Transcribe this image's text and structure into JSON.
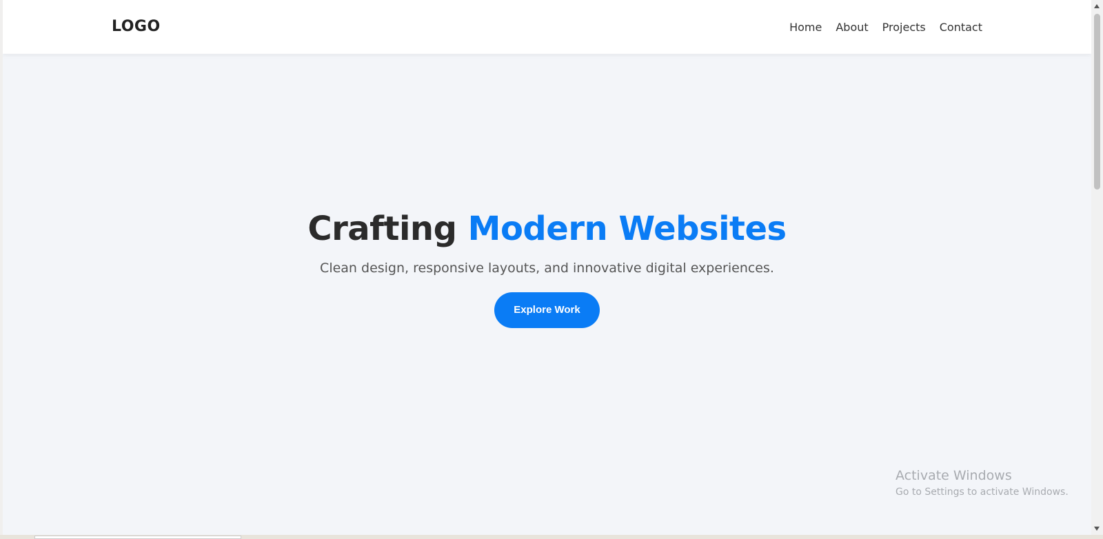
{
  "nav": {
    "logo": "LOGO",
    "links": [
      "Home",
      "About",
      "Projects",
      "Contact"
    ]
  },
  "hero": {
    "headline_plain": "Crafting ",
    "headline_accent": "Modern Websites",
    "subtitle": "Clean design, responsive layouts, and innovative digital experiences.",
    "cta_label": "Explore Work"
  },
  "watermark": {
    "title": "Activate Windows",
    "subtitle": "Go to Settings to activate Windows."
  },
  "colors": {
    "accent": "#0a7cf5",
    "page_background": "#f3f5f9",
    "navbar_background": "#ffffff",
    "text_dark": "#2b2b2b"
  }
}
